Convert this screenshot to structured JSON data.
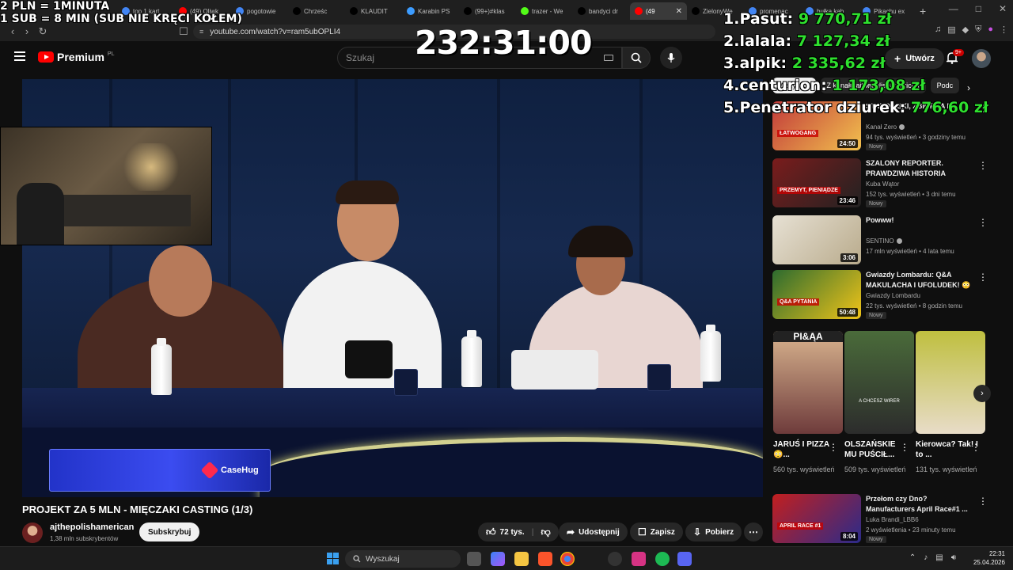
{
  "browser": {
    "tabs": [
      {
        "label": "top 1 kart",
        "color": "#4285f4"
      },
      {
        "label": "(49) Oliwk",
        "color": "#ff0000"
      },
      {
        "label": "pogotowie",
        "color": "#4285f4"
      },
      {
        "label": "Chrześc",
        "color": "#000000"
      },
      {
        "label": "KLAUDIT",
        "color": "#000000"
      },
      {
        "label": "Karabin PS",
        "color": "#3c9cff"
      },
      {
        "label": "(99+)#klas",
        "color": "#000000"
      },
      {
        "label": "trazer - We",
        "color": "#53fc18"
      },
      {
        "label": "bandyci dr",
        "color": "#000000"
      },
      {
        "label": "(49",
        "color": "#ff0000",
        "active": true
      },
      {
        "label": "ZielonyWe",
        "color": "#000000"
      },
      {
        "label": "promenac",
        "color": "#4285f4"
      },
      {
        "label": "bułka kab",
        "color": "#4285f4"
      },
      {
        "label": "Pikachu ex",
        "color": "#4285f4"
      }
    ],
    "url": "youtube.com/watch?v=ram5ubOPLI4"
  },
  "stream_overlay": {
    "line1": "2 PLN =  1MINUTA",
    "line2": "1 SUB = 8 MIN (SUB NIE KRĘCI KOŁEM)",
    "timer": "232:31:00",
    "leaderboard": [
      {
        "rank": "1.",
        "name": "Pasut:",
        "amount": "9 770,71 zł"
      },
      {
        "rank": "2.",
        "name": "lalala:",
        "amount": "7 127,34 zł"
      },
      {
        "rank": "3.",
        "name": "alpik:",
        "amount": "2 335,62 zł"
      },
      {
        "rank": "4.",
        "name": "centurion:",
        "amount": "1 173,08 zł"
      },
      {
        "rank": "5.",
        "name": "Penetrator dziurek:",
        "amount": "776,60 zł"
      }
    ]
  },
  "youtube": {
    "brand": "Premium",
    "region": "PL",
    "search_placeholder": "Szukaj",
    "create_label": "Utwórz",
    "notif_count": "9+",
    "sponsor": "CaseHug",
    "video_title": "PROJEKT ZA 5 MLN - MIĘCZAKI CASTING (1/3)",
    "channel": {
      "name": "ajthepolishamerican",
      "subs": "1,38 mln subskrybentów"
    },
    "subscribe_label": "Subskrybuj",
    "actions": {
      "likes": "72 tys.",
      "share": "Udostępnij",
      "save": "Zapisz",
      "download": "Pobierz"
    },
    "chips": [
      "Wszystko",
      "Z kanału ajthepolishamerican",
      "Podc"
    ],
    "recommendations": [
      {
        "title": "STANOWSKI, ZBIÓRKA I ...",
        "channel": "Kanał Zero",
        "verified": true,
        "meta": "94 tys. wyświetleń • 3 godziny temu",
        "badge": "Nowy",
        "duration": "24:50",
        "thumb_text": "ŁATWOGANG"
      },
      {
        "title": "SZALONY REPORTER. PRAWDZIWA HISTORIA",
        "channel": "Kuba Wątor",
        "verified": false,
        "meta": "152 tys. wyświetleń • 3 dni temu",
        "badge": "Nowy",
        "duration": "23:46",
        "thumb_text": "PRZEMYT, PIENIĄDZE"
      },
      {
        "title": "Powww!",
        "channel": "SENTINO",
        "verified": true,
        "meta": "17 mln wyświetleń • 4 lata temu",
        "badge": "",
        "duration": "3:06",
        "thumb_text": ""
      },
      {
        "title": "Gwiazdy Lombardu: Q&A MAKULACHA I UFOLUDEK! 😳",
        "channel": "Gwiazdy Lombardu",
        "verified": false,
        "meta": "22 tys. wyświetleń • 8 godzin temu",
        "badge": "Nowy",
        "duration": "50:48",
        "thumb_text": "Q&A PYTANIA"
      },
      {
        "title": "Przełom czy Dno? Manufacturers April Race#1 ...",
        "channel": "Luka Brandi_LBB6",
        "verified": false,
        "meta": "2 wyświetlenia • 23 minuty temu",
        "badge": "Nowy",
        "duration": "8:04",
        "thumb_text": "APRIL RACE #1"
      }
    ],
    "shorts": [
      {
        "title": "JARUŚ I PIZZA 😳...",
        "views": "560 tys. wyświetleń",
        "caption": "PI&ĄA"
      },
      {
        "title": "OLSZAŃSKIE MU PUŚCIŁ...",
        "views": "509 tys. wyświetleń",
        "caption": "A CHCESZ WIRER"
      },
      {
        "title": "Kierowca? Tak! I to ...",
        "views": "131 tys. wyświetleń",
        "caption": ""
      }
    ]
  },
  "taskbar": {
    "search_placeholder": "Wyszukaj",
    "time": "22:31",
    "date": "25.04.2026"
  },
  "colors": {
    "youtube_red": "#ff0000",
    "donation_green": "#2ee02e",
    "sponsor_blue": "#3b4cf0",
    "background": "#0f0f0f"
  }
}
